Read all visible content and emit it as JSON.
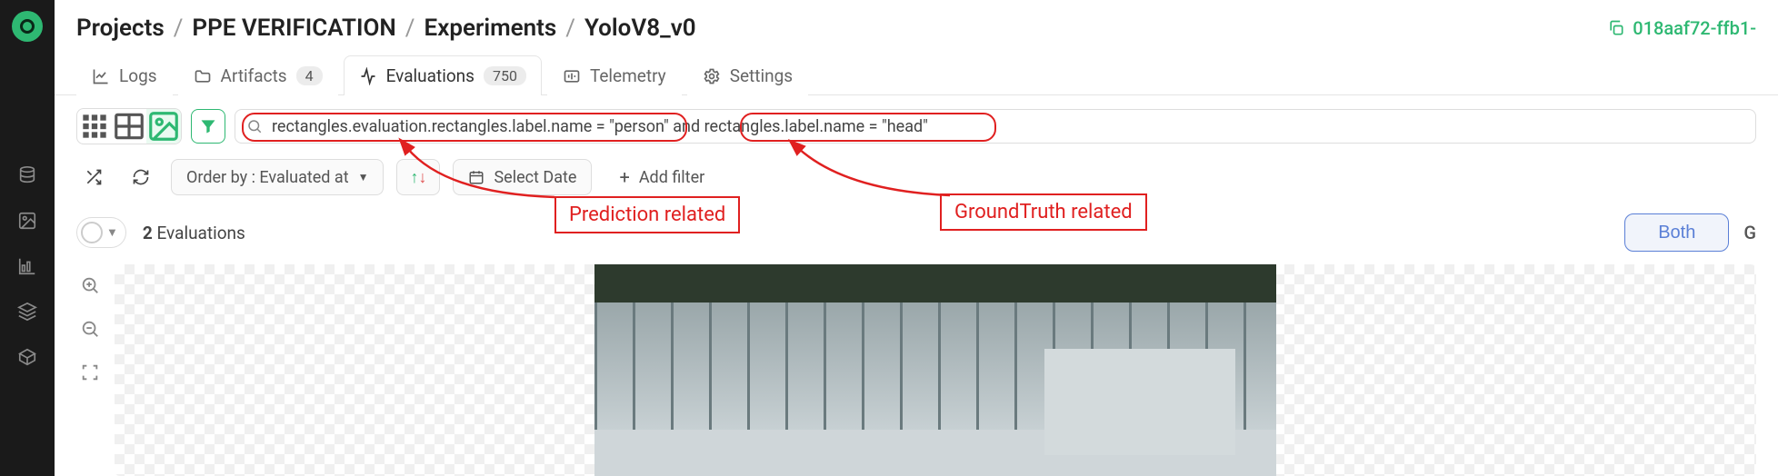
{
  "breadcrumb": [
    "Projects",
    "PPE VERIFICATION",
    "Experiments",
    "YoloV8_v0"
  ],
  "hash": "018aaf72-ffb1-",
  "tabs": [
    {
      "label": "Logs",
      "badge": null
    },
    {
      "label": "Artifacts",
      "badge": "4"
    },
    {
      "label": "Evaluations",
      "badge": "750"
    },
    {
      "label": "Telemetry",
      "badge": null
    },
    {
      "label": "Settings",
      "badge": null
    }
  ],
  "filter_query": "rectangles.evaluation.rectangles.label.name = \"person\" and rectangles.label.name = \"head\"",
  "order_by": "Order by : Evaluated at",
  "select_date": "Select Date",
  "add_filter": "Add filter",
  "eval_count": "2",
  "eval_label": "Evaluations",
  "both_label": "Both",
  "gt_label_partial": "G",
  "annot": {
    "pred": "Prediction related",
    "gt": "GroundTruth related"
  }
}
